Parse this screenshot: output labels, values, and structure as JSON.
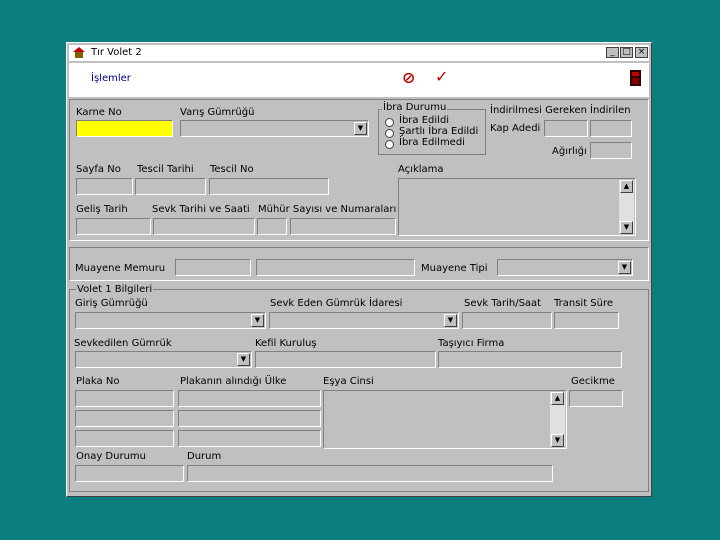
{
  "window": {
    "title": "Tır Volet 2",
    "minimize": "_",
    "maximize": "□",
    "close": "×"
  },
  "menu": {
    "islemler": "İşlemler",
    "cancel_icon": "⊘",
    "ok_icon": "✓"
  },
  "top": {
    "karne_no": "Karne No",
    "varis_gumrugu": "Varış Gümrüğü",
    "ibra_durumu": "İbra Durumu",
    "ibra_options": [
      "İbra Edildi",
      "Şartlı İbra Edildi",
      "İbra Edilmedi"
    ],
    "indirilmesi_gereken": "İndirilmesi Gereken",
    "indirilen": "İndirilen",
    "kap_adedi": "Kap Adedi",
    "agirligi": "Ağırlığı",
    "sayfa_no": "Sayfa No",
    "tescil_tarihi": "Tescil Tarihi",
    "tescil_no": "Tescil No",
    "aciklama": "Açıklama",
    "gelis_tarih": "Geliş Tarih",
    "sevk_tarihi_saati": "Sevk Tarihi ve Saati",
    "muhur_sayisi": "Mühür Sayısı ve Numaraları"
  },
  "mid": {
    "muayene_memuru": "Muayene Memuru",
    "muayene_tipi": "Muayene Tipi"
  },
  "volet": {
    "title": "Volet 1 Bilgileri",
    "giris_gumrugu": "Giriş Gümrüğü",
    "sevk_eden": "Sevk Eden Gümrük İdaresi",
    "sevk_tarih_saat": "Sevk Tarih/Saat",
    "transit_sure": "Transit Süre",
    "sevkedilen_gumruk": "Sevkedilen Gümrük",
    "kefil_kurulus": "Kefil Kuruluş",
    "tasiyici_firma": "Taşıyıcı Firma",
    "plaka_no": "Plaka No",
    "plakanin_ulke": "Plakanın alındığı Ülke",
    "esya_cinsi": "Eşya Cinsi",
    "gecikme": "Gecikme",
    "onay_durumu": "Onay Durumu",
    "durum": "Durum"
  }
}
